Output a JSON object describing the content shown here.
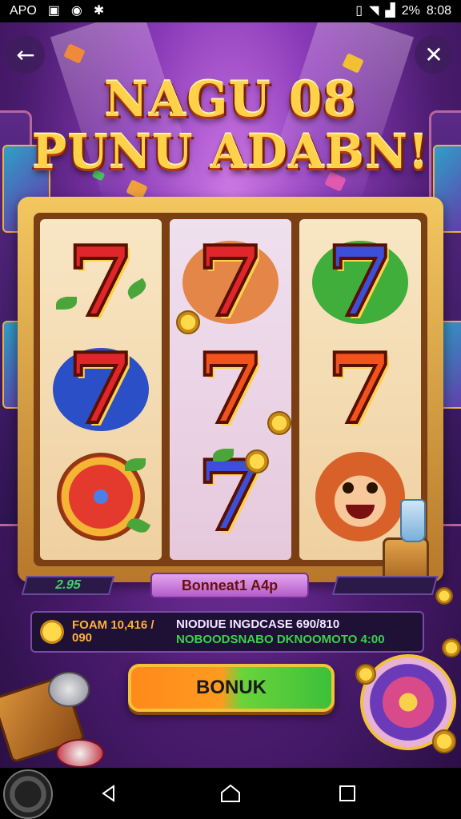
{
  "status_bar": {
    "carrier": "APO",
    "time": "8:08",
    "battery": "2%",
    "left_icons": [
      "image-icon",
      "messenger-icon",
      "settings-icon"
    ],
    "right_icons": [
      "vibrate-icon",
      "wifi-icon",
      "signal-icon"
    ]
  },
  "top_bar": {
    "back_icon": "arrow-left-icon",
    "close_icon": "close-icon"
  },
  "game": {
    "title_line1": "NAGU 08",
    "title_line2": "PUNU ADABN!",
    "reels": [
      [
        "red-seven",
        "blue-seven-splash",
        "candy"
      ],
      [
        "red-seven",
        "orange-seven",
        "blue-seven"
      ],
      [
        "blue-seven",
        "orange-seven",
        "lion"
      ]
    ],
    "seven_glyph": "7",
    "left_readout": "2.95",
    "bonus_label": "Bonneat1 A4p",
    "right_readout": ""
  },
  "info_panel": {
    "title": "FOAM 10,416 / 090",
    "line1": "NIODIUE INGDCASE 690/810",
    "line2": "NOBOODSNABO DKNOOMOTO 4:00"
  },
  "main_button": {
    "label": "BONUK"
  },
  "nav_bar": {
    "items": [
      "back-triangle-icon",
      "home-icon",
      "recents-square-icon"
    ]
  },
  "colors": {
    "title_gold": "#ffd24a",
    "button_orange": "#ff8a1a",
    "button_green": "#3cc03a",
    "panel_green": "#39d44a",
    "background_purple": "#4a1b6e"
  }
}
